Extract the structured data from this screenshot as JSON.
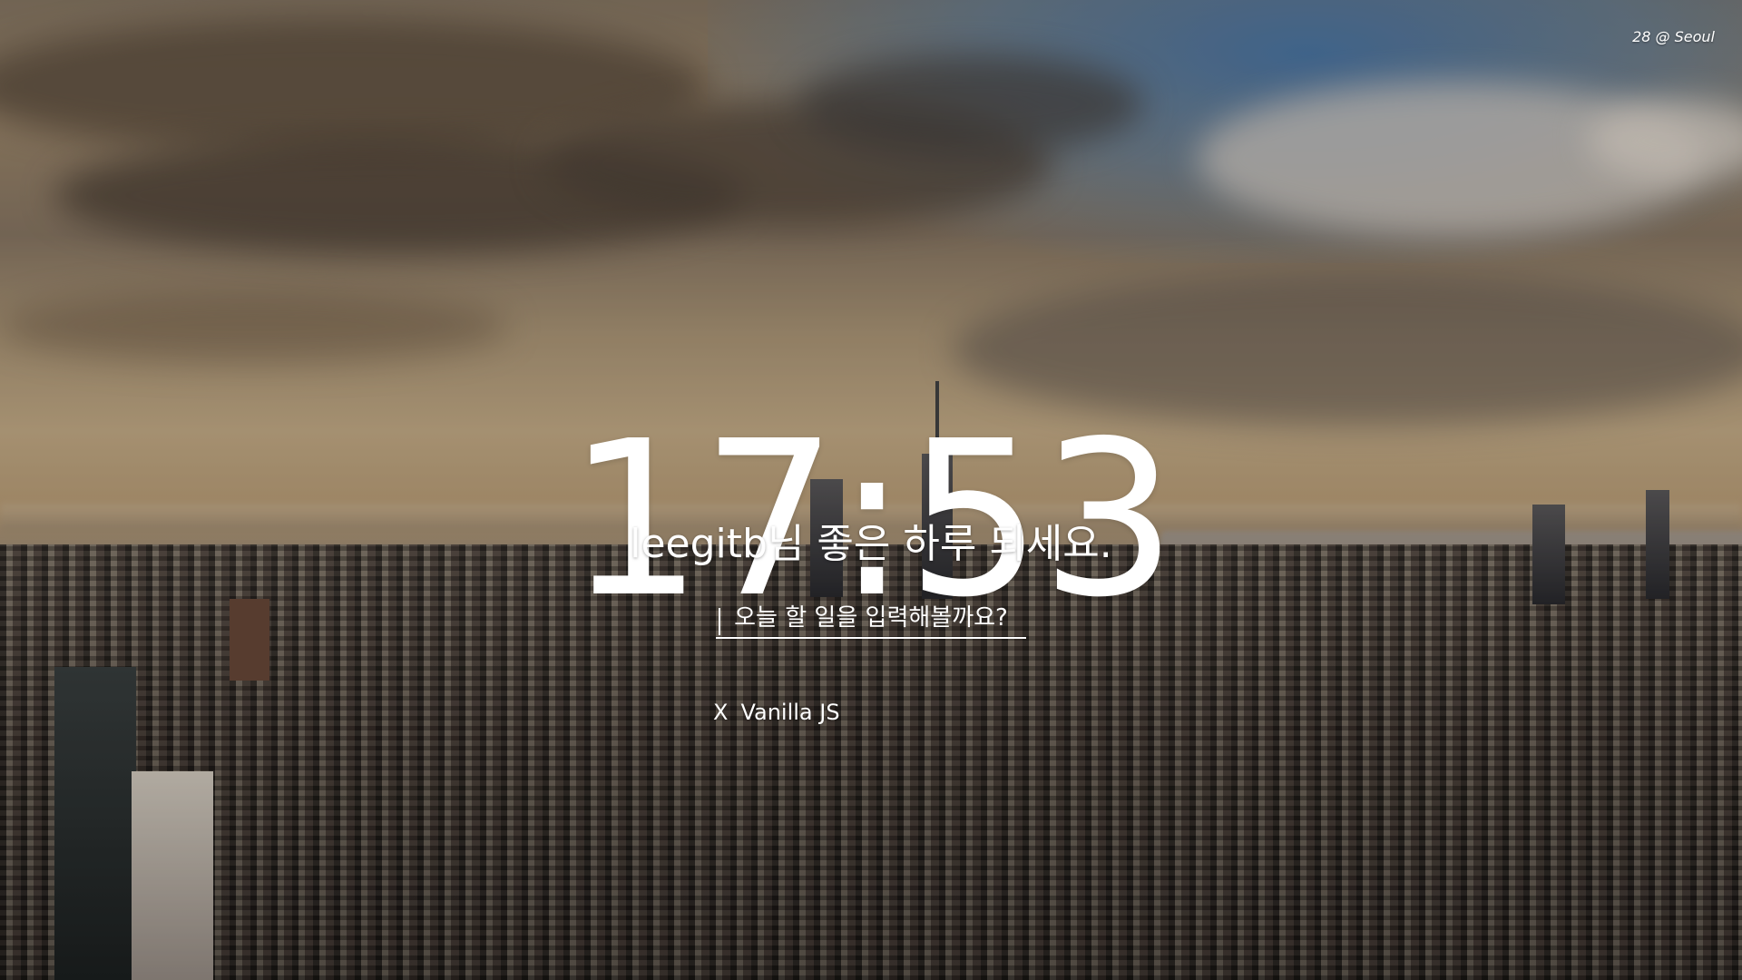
{
  "weather": {
    "text": "28 @ Seoul"
  },
  "clock": {
    "time": "17:53"
  },
  "greeting": {
    "text": "leegitb님 좋은 하루 되세요."
  },
  "todo": {
    "placeholder": "오늘 할 일을 입력해볼까요?",
    "items": [
      {
        "delete_label": "X",
        "text": "Vanilla JS"
      }
    ]
  }
}
